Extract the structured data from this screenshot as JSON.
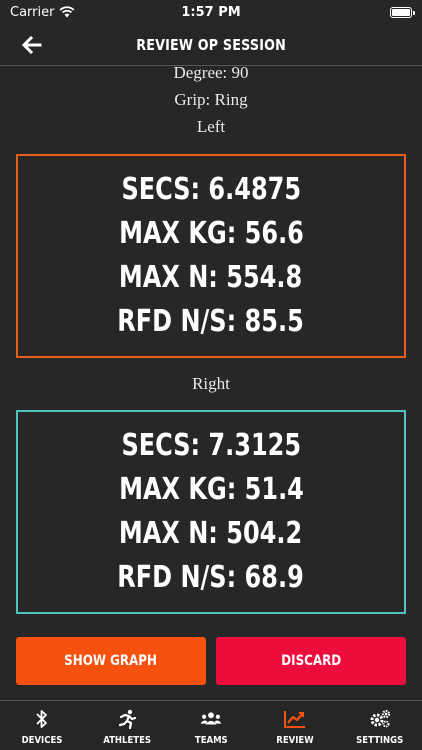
{
  "status_bar": {
    "carrier": "Carrier",
    "time": "1:57 PM"
  },
  "header": {
    "title": "REVIEW OP SESSION"
  },
  "session": {
    "degree": "Degree: 90",
    "grip": "Grip: Ring"
  },
  "left": {
    "label": "Left",
    "color": "#e8601c",
    "secs": "SECS: 6.4875",
    "max_kg": "MAX KG: 56.6",
    "max_n": "MAX N: 554.8",
    "rfd": "RFD N/S: 85.5"
  },
  "right": {
    "label": "Right",
    "color": "#4ec5c1",
    "secs": "SECS: 7.3125",
    "max_kg": "MAX KG: 51.4",
    "max_n": "MAX N: 504.2",
    "rfd": "RFD N/S: 68.9"
  },
  "actions": {
    "show_graph": "SHOW GRAPH",
    "show_graph_color": "#f6510e",
    "discard": "DISCARD",
    "discard_color": "#ed0d3d"
  },
  "tabs": [
    {
      "label": "DEVICES",
      "icon": "bluetooth-icon",
      "active": false
    },
    {
      "label": "ATHLETES",
      "icon": "runner-icon",
      "active": false
    },
    {
      "label": "TEAMS",
      "icon": "users-icon",
      "active": false
    },
    {
      "label": "REVIEW",
      "icon": "chart-icon",
      "active": true
    },
    {
      "label": "SETTINGS",
      "icon": "gears-icon",
      "active": false
    }
  ],
  "active_tab_color": "#f6510e"
}
